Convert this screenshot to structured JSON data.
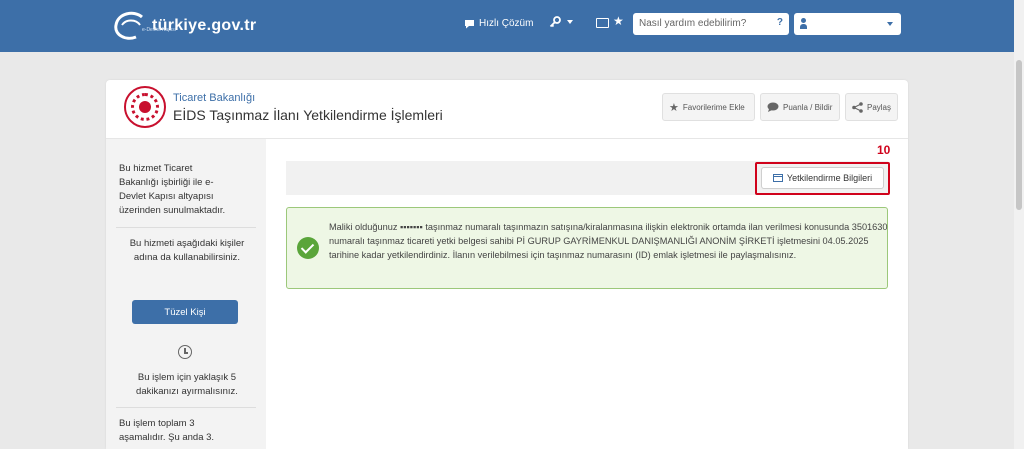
{
  "header": {
    "logo_text": "türkiye.gov.tr",
    "logo_sub": "e-Devlet Kapısı",
    "quick_solution": "Hızlı Çözüm",
    "search_placeholder": "Nasıl yardım edebilirim?",
    "search_icon": "?",
    "icons": [
      "chat-icon",
      "key-icon",
      "id-card-icon",
      "star-icon",
      "user-icon"
    ],
    "accent_color": "#3d6fa8"
  },
  "service": {
    "ministry": "Ticaret Bakanlığı",
    "title": "EİDS Taşınmaz İlanı Yetkilendirme İşlemleri",
    "buttons": {
      "favorite": "Favorilerime Ekle",
      "rate": "Puanla / Bildir",
      "share": "Paylaş"
    }
  },
  "sidebar": {
    "info1": "Bu hizmet Ticaret Bakanlığı işbirliği ile e-Devlet Kapısı altyapısı üzerinden sunulmaktadır.",
    "info2": "Bu hizmeti aşağıdaki kişiler adına da kullanabilirsiniz.",
    "tuzel_button": "Tüzel Kişi",
    "time_text": "Bu işlem için yaklaşık 5 dakikanızı ayırmalısınız.",
    "steps_text": "Bu işlem toplam 3 aşamalıdır. Şu anda 3."
  },
  "content": {
    "step_number": "10",
    "yetki_button": "Yetkilendirme Bilgileri",
    "alert_text": "Maliki olduğunuz ▪▪▪▪▪▪▪ taşınmaz numaralı taşınmazın satışına/kiralanmasına ilişkin elektronik ortamda ilan verilmesi konusunda 3501630 numaralı taşınmaz ticareti yetki belgesi sahibi Pİ GURUP GAYRİMENKUL DANIŞMANLIĞI ANONİM ŞİRKETİ işletmesini 04.05.2025 tarihine kadar yetkilendirdiniz. İlanın verilebilmesi için taşınmaz numarasını (ID) emlak işletmesi ile paylaşmalısınız.",
    "success_color": "#5aa53a",
    "highlight_color": "#d0021b"
  }
}
